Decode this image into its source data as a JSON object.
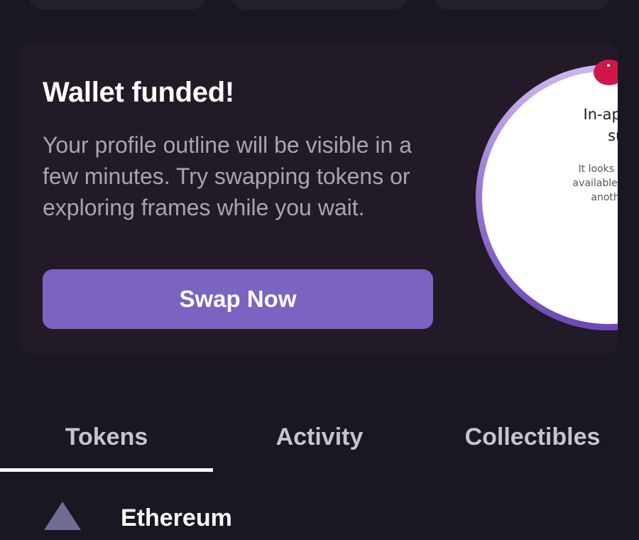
{
  "card": {
    "title": "Wallet funded!",
    "body": "Your profile outline will be visible in a few minutes. Try swapping tokens or exploring frames while you wait.",
    "button_label": "Swap Now",
    "illustration": {
      "heading": "In-app purch\nsuppo",
      "text": "It looks like in-app p\navailable on this devic\nanother device"
    }
  },
  "tabs": [
    {
      "label": "Tokens",
      "active": true
    },
    {
      "label": "Activity",
      "active": false
    },
    {
      "label": "Collectibles",
      "active": false
    }
  ],
  "list": {
    "first_item_title": "Ethereum",
    "first_item_icon": "ethereum-icon"
  },
  "colors": {
    "background": "#1a1723",
    "card": "#221a27",
    "accent": "#7b63c1",
    "tab_indicator": "#ffffff"
  }
}
